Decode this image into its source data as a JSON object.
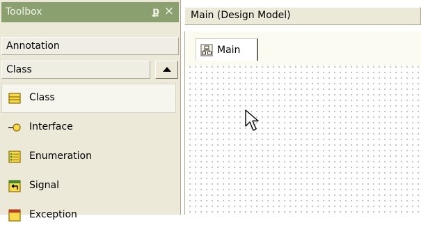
{
  "toolbox": {
    "title": "Toolbox",
    "pin_glyph": "ք",
    "close_glyph": "×",
    "tabs": [
      {
        "label": "Annotation"
      },
      {
        "label": "Class"
      }
    ],
    "items": [
      {
        "label": "Class",
        "icon": "class-icon",
        "selected": true
      },
      {
        "label": "Interface",
        "icon": "interface-lollipop-icon",
        "selected": false
      },
      {
        "label": "Enumeration",
        "icon": "enumeration-icon",
        "selected": false
      },
      {
        "label": "Signal",
        "icon": "signal-icon",
        "selected": false
      },
      {
        "label": "Exception",
        "icon": "exception-icon",
        "selected": false
      }
    ]
  },
  "document": {
    "title": "Main (Design Model)",
    "tabs": [
      {
        "label": "Main",
        "icon": "diagram-icon"
      }
    ]
  },
  "colors": {
    "toolbox_title_bg": "#8aa06e",
    "panel_bg": "#ece9d8",
    "icon_yellow": "#f7d94c",
    "icon_green": "#3a8a2e",
    "icon_red": "#c0392b"
  }
}
